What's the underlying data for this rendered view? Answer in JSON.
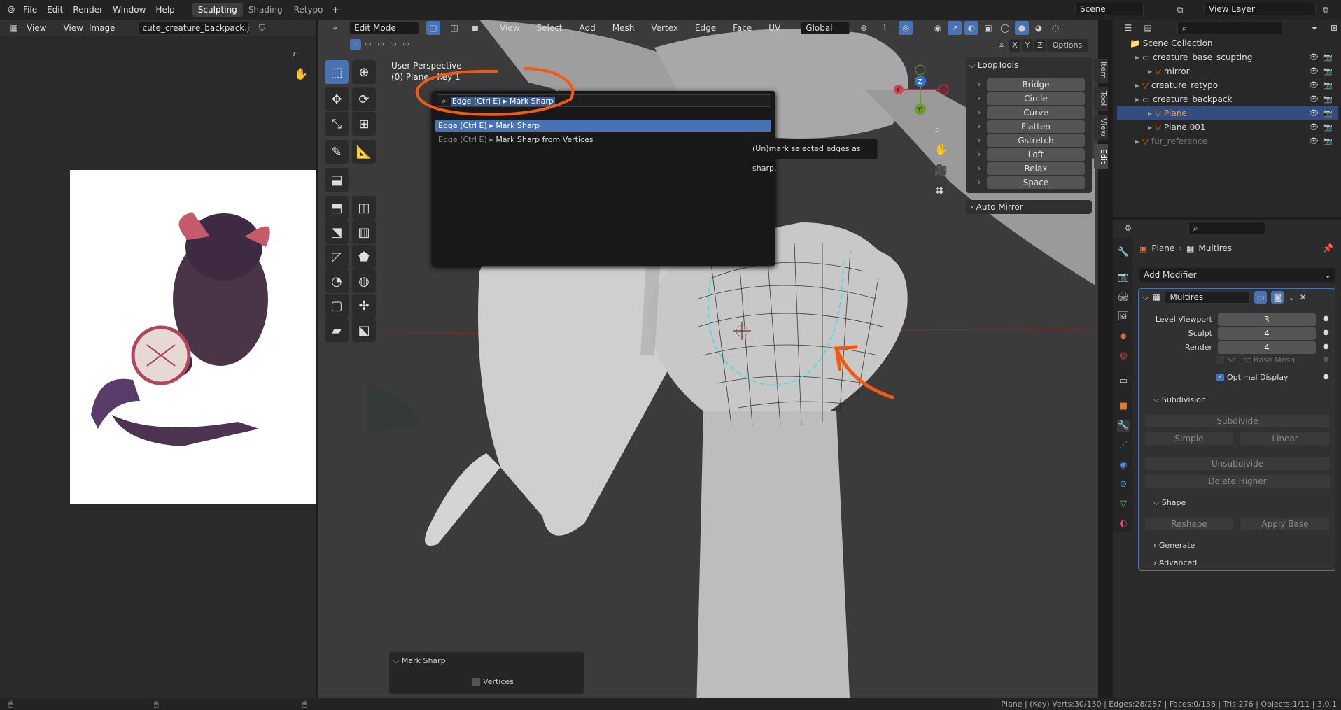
{
  "topbar": {
    "menus": [
      "File",
      "Edit",
      "Render",
      "Window",
      "Help"
    ],
    "workspaces": [
      "Sculpting",
      "Shading",
      "Retypo"
    ],
    "scene": "Scene",
    "view_layer": "View Layer"
  },
  "image_editor": {
    "view": "View",
    "menu_view": "View",
    "menu_image": "Image",
    "image_name": "cute_creature_backpack.jpg"
  },
  "viewport": {
    "mode": "Edit Mode",
    "menus": [
      "View",
      "Select",
      "Add",
      "Mesh",
      "Vertex",
      "Edge",
      "Face",
      "UV"
    ],
    "orientation": "Global",
    "info_line1": "User Perspective",
    "info_line2": "(0) Plane : Key 1",
    "axes": [
      "X",
      "Y",
      "Z"
    ],
    "options": "Options"
  },
  "search": {
    "query": "Edge (Ctrl E) ▸ Mark Sharp",
    "results": [
      {
        "prefix": "Edge (Ctrl E)",
        "sep": "▸",
        "label": "Mark Sharp"
      },
      {
        "prefix": "Edge (Ctrl E)",
        "sep": "▸",
        "label": "Mark Sharp from Vertices"
      }
    ],
    "tooltip": "(Un)mark selected edges as sharp."
  },
  "loop_tools": {
    "title": "LoopTools",
    "items": [
      "Bridge",
      "Circle",
      "Curve",
      "Flatten",
      "Gstretch",
      "Loft",
      "Relax",
      "Space"
    ],
    "auto_mirror": "Auto Mirror"
  },
  "side_tabs": [
    "Item",
    "Tool",
    "View",
    "Edit"
  ],
  "last_op": {
    "title": "Mark Sharp",
    "vertices": "Vertices"
  },
  "outliner": {
    "title": "Scene Collection",
    "rows": [
      {
        "label": "creature_base_scupting",
        "depth": 1,
        "type": "collection"
      },
      {
        "label": "mirror",
        "depth": 2,
        "type": "object"
      },
      {
        "label": "creature_retypo",
        "depth": 1,
        "type": "object"
      },
      {
        "label": "creature_backpack",
        "depth": 1,
        "type": "collection"
      },
      {
        "label": "Plane",
        "depth": 2,
        "type": "mesh"
      },
      {
        "label": "Plane.001",
        "depth": 2,
        "type": "mesh"
      },
      {
        "label": "fur_reference",
        "depth": 1,
        "type": "object"
      }
    ]
  },
  "properties": {
    "breadcrumb_object": "Plane",
    "breadcrumb_modifier": "Multires",
    "add_modifier": "Add Modifier",
    "modifier_name": "Multires",
    "levels": [
      {
        "label": "Level Viewport",
        "value": "3"
      },
      {
        "label": "Sculpt",
        "value": "4"
      },
      {
        "label": "Render",
        "value": "4"
      }
    ],
    "sculpt_base_mesh": "Sculpt Base Mesh",
    "optimal_display": "Optimal Display",
    "subdivision": "Subdivision",
    "subdivide": "Subdivide",
    "simple": "Simple",
    "linear": "Linear",
    "unsubdivide": "Unsubdivide",
    "delete_higher": "Delete Higher",
    "shape": "Shape",
    "reshape": "Reshape",
    "apply_base": "Apply Base",
    "generate": "Generate",
    "advanced": "Advanced"
  },
  "statusbar": {
    "text": "Plane | (Key) Verts:30/150 | Edges:28/287 | Faces:0/138 | Tris:276 | Objects:1/11 | 3.0.1"
  },
  "colors": {
    "accent": "#4772b3",
    "annotation": "#f25a12",
    "seam": "#5fd6d6"
  }
}
